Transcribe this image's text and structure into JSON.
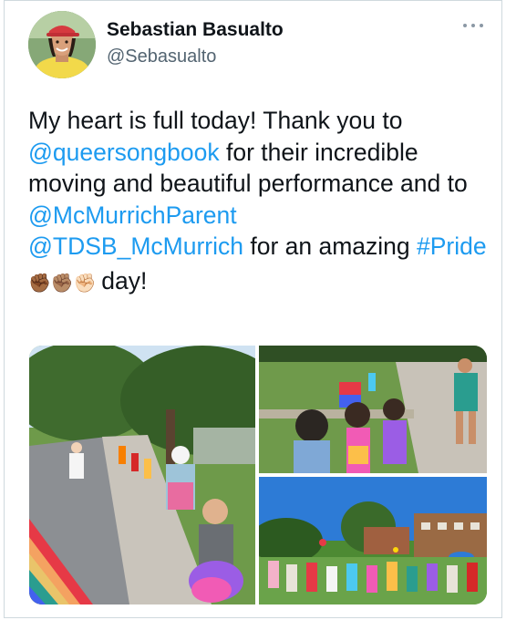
{
  "tweet": {
    "author_name": "Sebastian Basualto",
    "author_handle": "@Sebasualto",
    "text_parts": [
      {
        "text": "My heart is full today! Thank you to ",
        "type": "plain"
      },
      {
        "text": "@queersongbook",
        "type": "mention"
      },
      {
        "text": " for their incredible moving and beautiful performance and to ",
        "type": "plain"
      },
      {
        "text": "@McMurrichParent",
        "type": "mention"
      },
      {
        "text": " ",
        "type": "plain"
      },
      {
        "text": "@TDSB_McMurrich",
        "type": "mention"
      },
      {
        "text": " for an amazing ",
        "type": "plain"
      },
      {
        "text": "#Pride",
        "type": "hashtag"
      },
      {
        "text": " ✊🏾✊🏽✊🏻 ",
        "type": "emoji"
      },
      {
        "text": "day!",
        "type": "plain"
      }
    ],
    "icons": {
      "more": "more-options-icon"
    },
    "photos": [
      {
        "name": "photo-children-sidewalk"
      },
      {
        "name": "photo-kids-flags-path"
      },
      {
        "name": "photo-field-gathering"
      }
    ]
  },
  "colors": {
    "link": "#1d9bf0",
    "text": "#0f1419",
    "secondary": "#536471",
    "border": "#cfd9de"
  }
}
